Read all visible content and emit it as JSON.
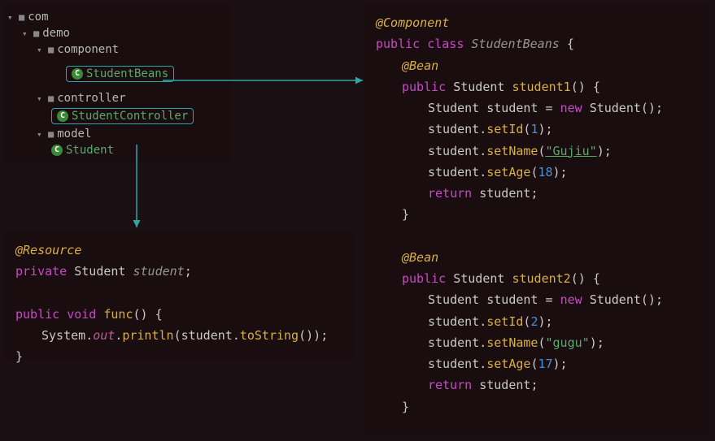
{
  "tree": {
    "com": "com",
    "demo": "demo",
    "component": "component",
    "studentBeans": "StudentBeans",
    "controller": "controller",
    "studentController": "StudentController",
    "model": "model",
    "student": "Student"
  },
  "snippetA": {
    "ann": "@Resource",
    "private": "private",
    "studentType": "Student",
    "studentVar": "student",
    "semi": ";",
    "public": "public",
    "void": "void",
    "func": "func",
    "parens": "()",
    "lbrace": "{",
    "system": "System",
    "dot1": ".",
    "out": "out",
    "dot2": ".",
    "println": "println",
    "lp": "(",
    "studentRef": "student",
    "dot3": ".",
    "toString": "toString",
    "rpp": "())",
    "semi2": ";",
    "rbrace": "}"
  },
  "snippetB": {
    "componentAnn": "@Component",
    "public": "public",
    "class": "class",
    "className": "StudentBeans",
    "lbrace": "{",
    "beanAnn1": "@Bean",
    "studentType": "Student",
    "m1name": "student1",
    "parens": "()",
    "assign": "=",
    "new": "new",
    "ctor": "Student",
    "studentVar": "student",
    "setId": "setId",
    "setName": "setName",
    "setAge": "setAge",
    "return": "return",
    "name1": "\"Gujiu\"",
    "id1": "1",
    "age1": "18",
    "beanAnn2": "@Bean",
    "m2name": "student2",
    "name2": "\"gugu\"",
    "id2": "2",
    "age2": "17",
    "rbrace": "}",
    "semi": ";",
    "dot": ".",
    "lp": "(",
    "rp": ")",
    "rpsemi": ");",
    "ctorTail": "();"
  }
}
